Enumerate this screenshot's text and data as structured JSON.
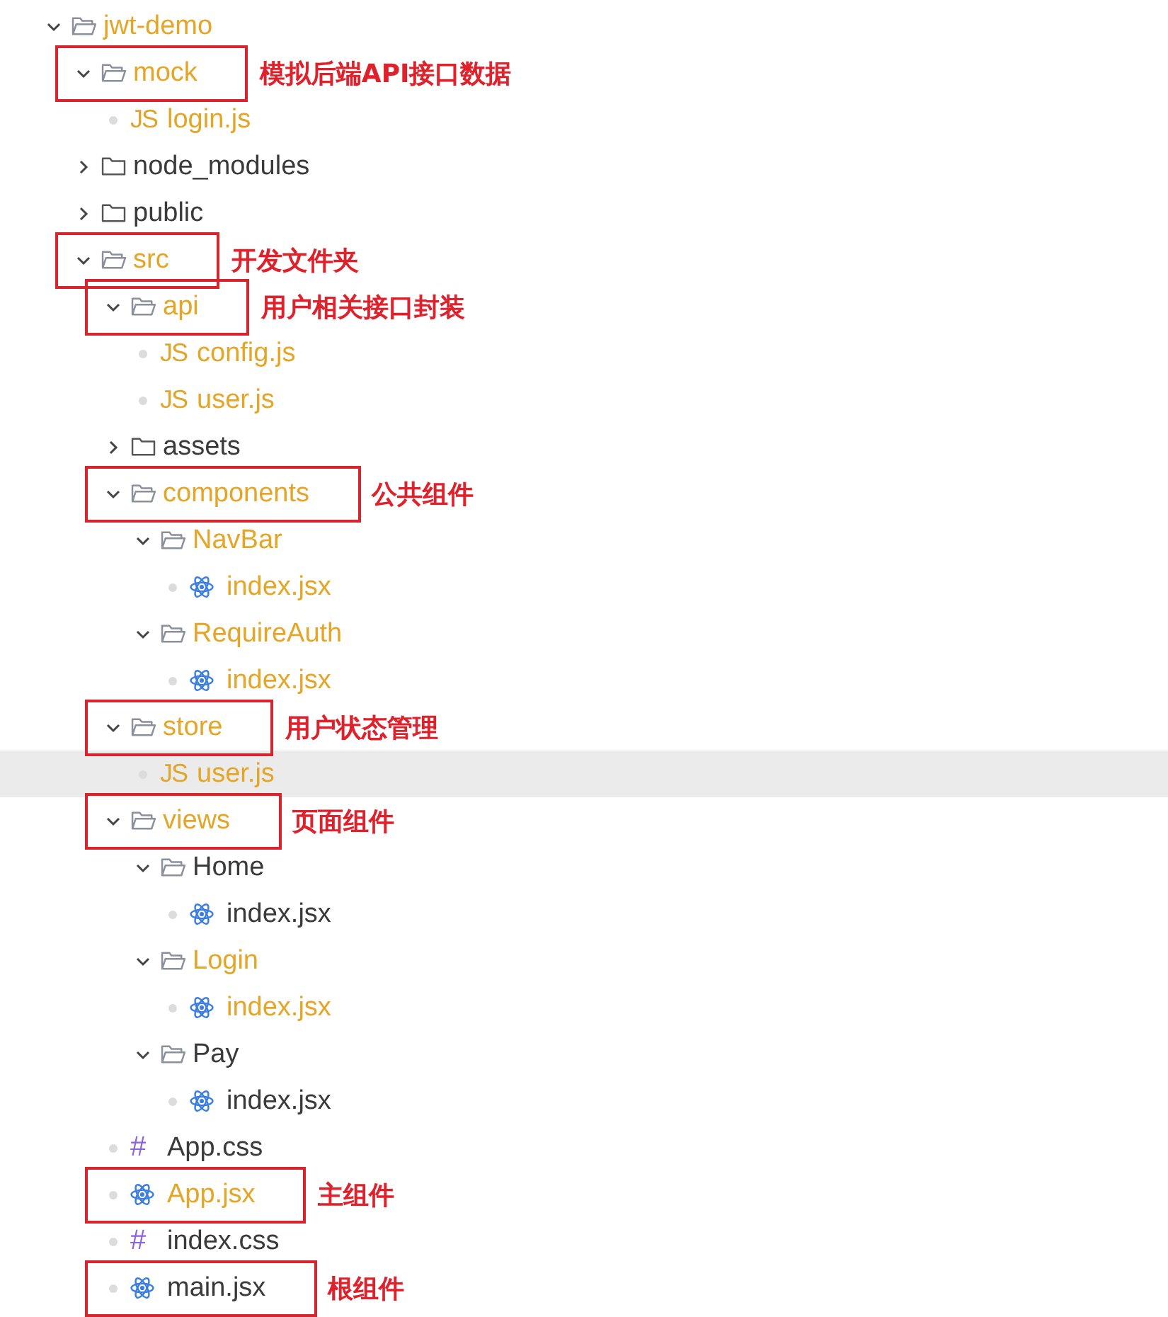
{
  "tree": [
    {
      "name": "jwt-demo",
      "kind": "folder",
      "expanded": true,
      "modified": true,
      "selected": false,
      "children": [
        {
          "name": "mock",
          "kind": "folder",
          "expanded": true,
          "modified": true,
          "selected": false,
          "note": "模拟后端API接口数据",
          "children": [
            {
              "name": "login.js",
              "kind": "js",
              "icon_text": "JS",
              "modified": true,
              "selected": false
            }
          ]
        },
        {
          "name": "node_modules",
          "kind": "folder",
          "expanded": false,
          "modified": false,
          "selected": false
        },
        {
          "name": "public",
          "kind": "folder",
          "expanded": false,
          "modified": false,
          "selected": false
        },
        {
          "name": "src",
          "kind": "folder",
          "expanded": true,
          "modified": true,
          "selected": false,
          "note": "开发文件夹",
          "children": [
            {
              "name": "api",
              "kind": "folder",
              "expanded": true,
              "modified": true,
              "selected": false,
              "note": "用户相关接口封装",
              "children": [
                {
                  "name": "config.js",
                  "kind": "js",
                  "icon_text": "JS",
                  "modified": true,
                  "selected": false
                },
                {
                  "name": "user.js",
                  "kind": "js",
                  "icon_text": "JS",
                  "modified": true,
                  "selected": false
                }
              ]
            },
            {
              "name": "assets",
              "kind": "folder",
              "expanded": false,
              "modified": false,
              "selected": false
            },
            {
              "name": "components",
              "kind": "folder",
              "expanded": true,
              "modified": true,
              "selected": false,
              "note": "公共组件",
              "children": [
                {
                  "name": "NavBar",
                  "kind": "folder",
                  "expanded": true,
                  "modified": true,
                  "selected": false,
                  "children": [
                    {
                      "name": "index.jsx",
                      "kind": "react",
                      "modified": true,
                      "selected": false
                    }
                  ]
                },
                {
                  "name": "RequireAuth",
                  "kind": "folder",
                  "expanded": true,
                  "modified": true,
                  "selected": false,
                  "children": [
                    {
                      "name": "index.jsx",
                      "kind": "react",
                      "modified": true,
                      "selected": false
                    }
                  ]
                }
              ]
            },
            {
              "name": "store",
              "kind": "folder",
              "expanded": true,
              "modified": true,
              "selected": false,
              "note": "用户状态管理",
              "children": [
                {
                  "name": "user.js",
                  "kind": "js",
                  "icon_text": "JS",
                  "modified": true,
                  "selected": true
                }
              ]
            },
            {
              "name": "views",
              "kind": "folder",
              "expanded": true,
              "modified": true,
              "selected": false,
              "note": "页面组件",
              "children": [
                {
                  "name": "Home",
                  "kind": "folder",
                  "expanded": true,
                  "modified": false,
                  "selected": false,
                  "children": [
                    {
                      "name": "index.jsx",
                      "kind": "react",
                      "modified": false,
                      "selected": false
                    }
                  ]
                },
                {
                  "name": "Login",
                  "kind": "folder",
                  "expanded": true,
                  "modified": true,
                  "selected": false,
                  "children": [
                    {
                      "name": "index.jsx",
                      "kind": "react",
                      "modified": true,
                      "selected": false
                    }
                  ]
                },
                {
                  "name": "Pay",
                  "kind": "folder",
                  "expanded": true,
                  "modified": false,
                  "selected": false,
                  "children": [
                    {
                      "name": "index.jsx",
                      "kind": "react",
                      "modified": false,
                      "selected": false
                    }
                  ]
                }
              ]
            },
            {
              "name": "App.css",
              "kind": "css",
              "icon_text": "#",
              "modified": false,
              "selected": false
            },
            {
              "name": "App.jsx",
              "kind": "react",
              "modified": true,
              "selected": false,
              "note": "主组件"
            },
            {
              "name": "index.css",
              "kind": "css",
              "icon_text": "#",
              "modified": false,
              "selected": false
            },
            {
              "name": "main.jsx",
              "kind": "react",
              "modified": false,
              "selected": false,
              "note": "根组件"
            }
          ]
        }
      ]
    }
  ]
}
